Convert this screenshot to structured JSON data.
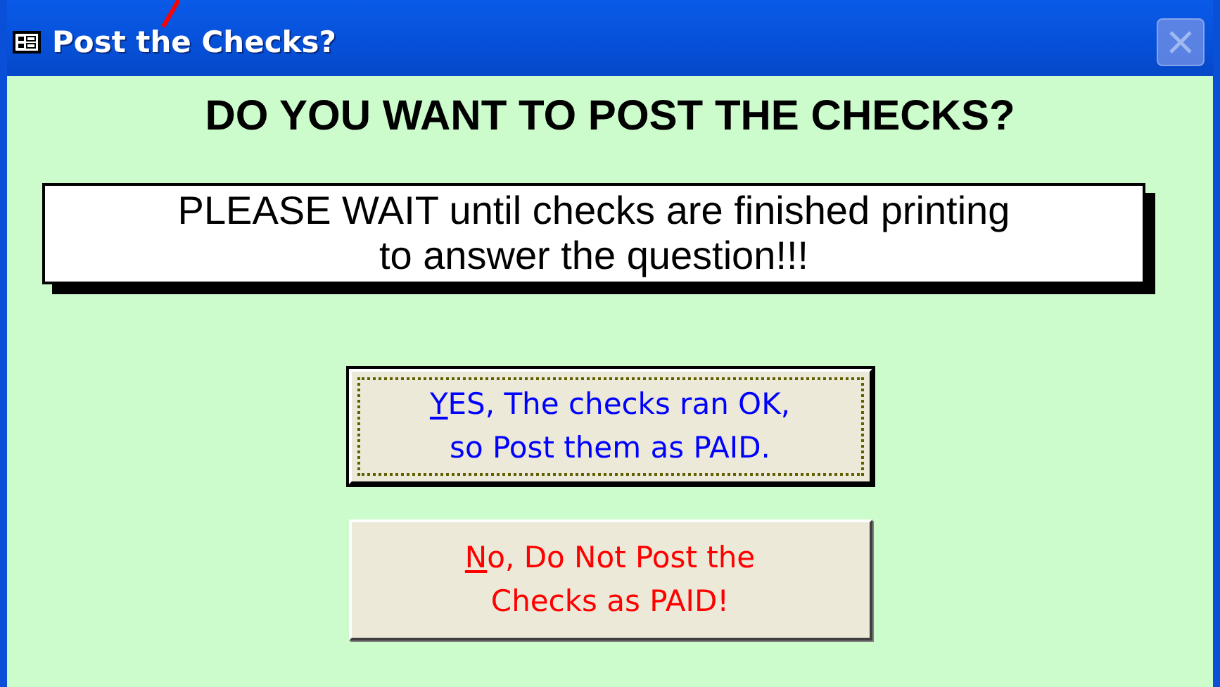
{
  "window": {
    "title": "Post the Checks?"
  },
  "heading": "DO YOU WANT TO POST THE CHECKS?",
  "message": [
    "PLEASE WAIT until checks are finished printing",
    "to answer the question!!!"
  ],
  "buttons": [
    {
      "key": "Y",
      "rest": "ES, The checks ran OK,",
      "line2": "so  Post them as PAID.",
      "color": "#0000ff",
      "focused": true
    },
    {
      "key": "N",
      "rest": "o, Do Not Post the",
      "line2": "Checks as PAID!",
      "color": "#ff0000",
      "focused": false
    }
  ]
}
